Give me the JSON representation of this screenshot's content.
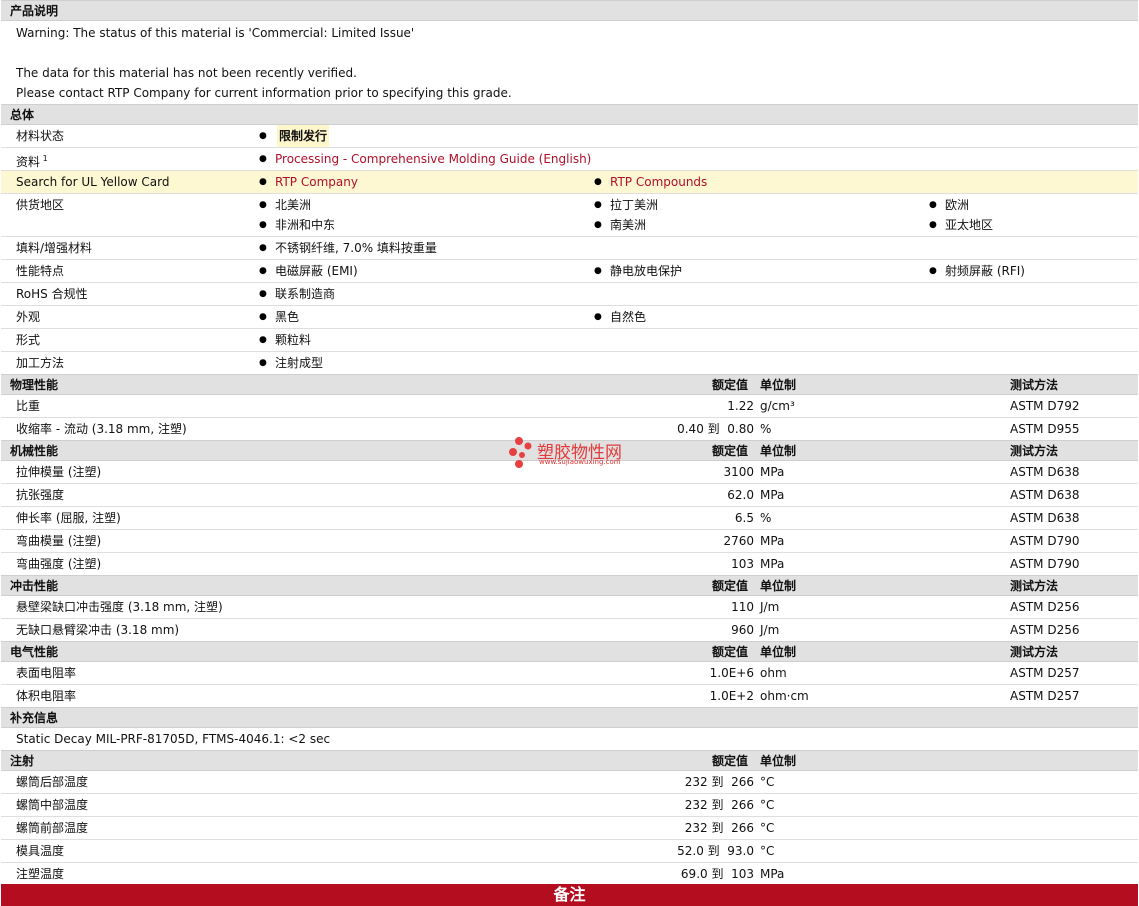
{
  "desc": {
    "title": "产品说明",
    "warning": "Warning: The status of this material is 'Commercial: Limited Issue'",
    "line2": "The data for this material has not been recently verified.",
    "line3": "Please contact RTP Company for current information prior to specifying this grade."
  },
  "general": {
    "title": "总体",
    "status_label": "材料状态",
    "status_value": "限制发行",
    "docs_label": "资料",
    "docs_sup": "1",
    "docs_link": "Processing - Comprehensive Molding Guide (English)",
    "ul_label": "Search for UL Yellow Card",
    "ul_link1": "RTP Company",
    "ul_link2": "RTP Compounds",
    "supply_label": "供货地区",
    "supply": [
      "北美洲",
      "拉丁美洲",
      "欧洲",
      "非洲和中东",
      "南美洲",
      "亚太地区"
    ],
    "filler_label": "填料/增强材料",
    "filler_value": "不锈钢纤维, 7.0% 填料按重量",
    "features_label": "性能特点",
    "features": [
      "电磁屏蔽 (EMI)",
      "静电放电保护",
      "射频屏蔽 (RFI)"
    ],
    "rohs_label": "RoHS 合规性",
    "rohs_value": "联系制造商",
    "appearance_label": "外观",
    "appearance": [
      "黑色",
      "自然色"
    ],
    "form_label": "形式",
    "form_value": "颗粒料",
    "process_label": "加工方法",
    "process_value": "注射成型"
  },
  "headers": {
    "nominal": "额定值",
    "unit": "单位制",
    "method": "测试方法"
  },
  "physical": {
    "title": "物理性能",
    "rows": [
      {
        "label": "比重",
        "value": "1.22",
        "unit": "g/cm³",
        "method": "ASTM D792"
      },
      {
        "label": "收缩率 - 流动 (3.18 mm, 注塑)",
        "value": "0.40 到  0.80",
        "unit": "%",
        "method": "ASTM D955"
      }
    ]
  },
  "mechanical": {
    "title": "机械性能",
    "rows": [
      {
        "label": "拉伸模量 (注塑)",
        "value": "3100",
        "unit": "MPa",
        "method": "ASTM D638"
      },
      {
        "label": "抗张强度",
        "value": "62.0",
        "unit": "MPa",
        "method": "ASTM D638"
      },
      {
        "label": "伸长率 (屈服, 注塑)",
        "value": "6.5",
        "unit": "%",
        "method": "ASTM D638"
      },
      {
        "label": "弯曲模量 (注塑)",
        "value": "2760",
        "unit": "MPa",
        "method": "ASTM D790"
      },
      {
        "label": "弯曲强度 (注塑)",
        "value": "103",
        "unit": "MPa",
        "method": "ASTM D790"
      }
    ]
  },
  "impact": {
    "title": "冲击性能",
    "rows": [
      {
        "label": "悬壁梁缺口冲击强度 (3.18 mm, 注塑)",
        "value": "110",
        "unit": "J/m",
        "method": "ASTM D256"
      },
      {
        "label": "无缺口悬臂梁冲击 (3.18 mm)",
        "value": "960",
        "unit": "J/m",
        "method": "ASTM D256"
      }
    ]
  },
  "electrical": {
    "title": "电气性能",
    "rows": [
      {
        "label": "表面电阻率",
        "value": "1.0E+6",
        "unit": "ohm",
        "method": "ASTM D257"
      },
      {
        "label": "体积电阻率",
        "value": "1.0E+2",
        "unit": "ohm·cm",
        "method": "ASTM D257"
      }
    ]
  },
  "supplement": {
    "title": "补充信息",
    "text": "Static Decay MIL-PRF-81705D, FTMS-4046.1: <2 sec"
  },
  "injection": {
    "title": "注射",
    "rows": [
      {
        "label": "螺筒后部温度",
        "value": "232 到  266",
        "unit": "°C"
      },
      {
        "label": "螺筒中部温度",
        "value": "232 到  266",
        "unit": "°C"
      },
      {
        "label": "螺筒前部温度",
        "value": "232 到  266",
        "unit": "°C"
      },
      {
        "label": "模具温度",
        "value": "52.0 到  93.0",
        "unit": "°C"
      },
      {
        "label": "注塑温度",
        "value": "69.0 到  103",
        "unit": "MPa"
      }
    ]
  },
  "watermark": {
    "name": "塑胶物性网",
    "url": "www.sujiaowuxing.com"
  },
  "footer": {
    "label": "备注"
  },
  "colors": {
    "link": "#b0102a",
    "footer_bg": "#b50d20",
    "section_bg": "#e1e1e1",
    "highlight_row": "#fdf7d2"
  }
}
